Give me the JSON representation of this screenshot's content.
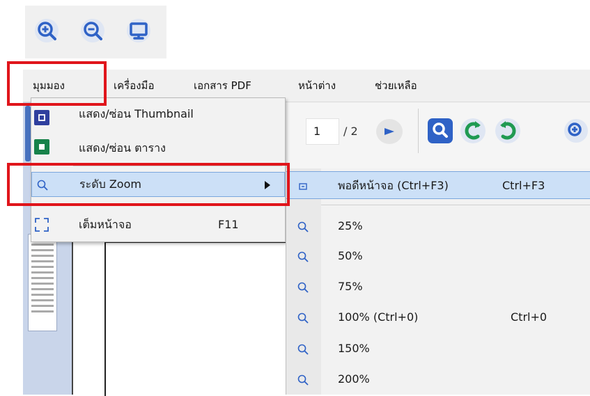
{
  "colors": {
    "accent": "#2f62c6",
    "highlight_box": "#e0151b",
    "menu_hover": "#cce0f7",
    "green": "#1f9a52"
  },
  "top_icons": [
    "zoom-in-icon",
    "zoom-out-icon",
    "monitor-icon"
  ],
  "menubar": {
    "items": [
      {
        "label": "มุมมอง"
      },
      {
        "label": "เครื่องมือ"
      },
      {
        "label": "เอกสาร PDF"
      },
      {
        "label": "หน้าต่าง"
      },
      {
        "label": "ช่วยเหลือ"
      }
    ]
  },
  "toolbar": {
    "page_number": "1",
    "page_total": "/ 2"
  },
  "view_menu": {
    "items": [
      {
        "label": "แสดง/ซ่อน Thumbnail",
        "icon": "thumbnail-toggle-icon"
      },
      {
        "label": "แสดง/ซ่อน ตาราง",
        "icon": "table-toggle-icon"
      },
      {
        "label": "ระดับ Zoom",
        "icon": "magnifier-icon",
        "has_submenu": true
      },
      {
        "label": "เต็มหน้าจอ",
        "shortcut": "F11",
        "icon": "fullscreen-icon"
      }
    ]
  },
  "zoom_submenu": {
    "fit": {
      "label": "พอดีหน้าจอ  (Ctrl+F3)",
      "shortcut": "Ctrl+F3"
    },
    "items": [
      {
        "label": "25%",
        "shortcut": ""
      },
      {
        "label": "50%",
        "shortcut": ""
      },
      {
        "label": "75%",
        "shortcut": ""
      },
      {
        "label": "100%  (Ctrl+0)",
        "shortcut": "Ctrl+0"
      },
      {
        "label": "150%",
        "shortcut": ""
      },
      {
        "label": "200%",
        "shortcut": ""
      }
    ]
  }
}
